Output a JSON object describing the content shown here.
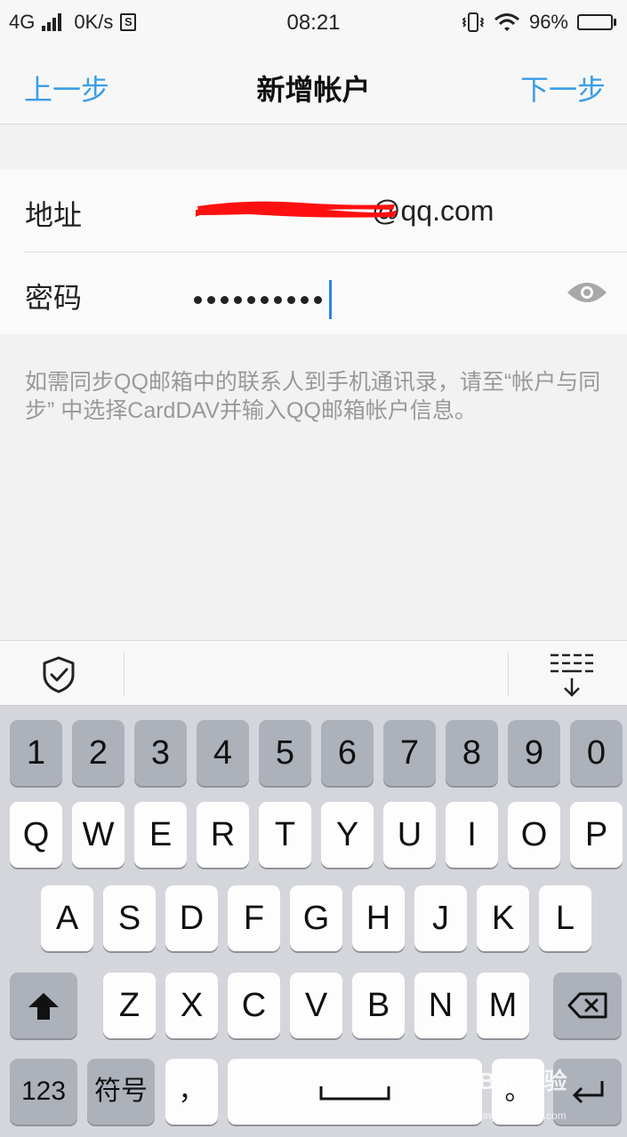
{
  "status_bar": {
    "network": "4G",
    "speed": "0K/s",
    "sim_badge": "S",
    "time": "08:21",
    "battery": "96%"
  },
  "nav": {
    "back_label": "上一步",
    "title": "新增帐户",
    "next_label": "下一步"
  },
  "form": {
    "address_label": "地址",
    "address_value": "@qq.com",
    "password_label": "密码",
    "password_masked_length": 10
  },
  "hint": "如需同步QQ邮箱中的联系人到手机通讯录，请至“帐户与同步” 中选择CardDAV并输入QQ邮箱帐户信息。",
  "keyboard": {
    "numbers": [
      "1",
      "2",
      "3",
      "4",
      "5",
      "6",
      "7",
      "8",
      "9",
      "0"
    ],
    "row_q": [
      "Q",
      "W",
      "E",
      "R",
      "T",
      "Y",
      "U",
      "I",
      "O",
      "P"
    ],
    "row_a": [
      "A",
      "S",
      "D",
      "F",
      "G",
      "H",
      "J",
      "K",
      "L"
    ],
    "row_z": [
      "Z",
      "X",
      "C",
      "V",
      "B",
      "N",
      "M"
    ],
    "key_123": "123",
    "key_symbols": "符号",
    "key_comma": "，",
    "key_period": "。"
  },
  "watermark": {
    "brand": "Bai 经验",
    "url": "jingyan.baidu.com"
  },
  "colors": {
    "accent": "#3a9ee6",
    "caret": "#2a86e0",
    "redaction": "#ff0000"
  }
}
